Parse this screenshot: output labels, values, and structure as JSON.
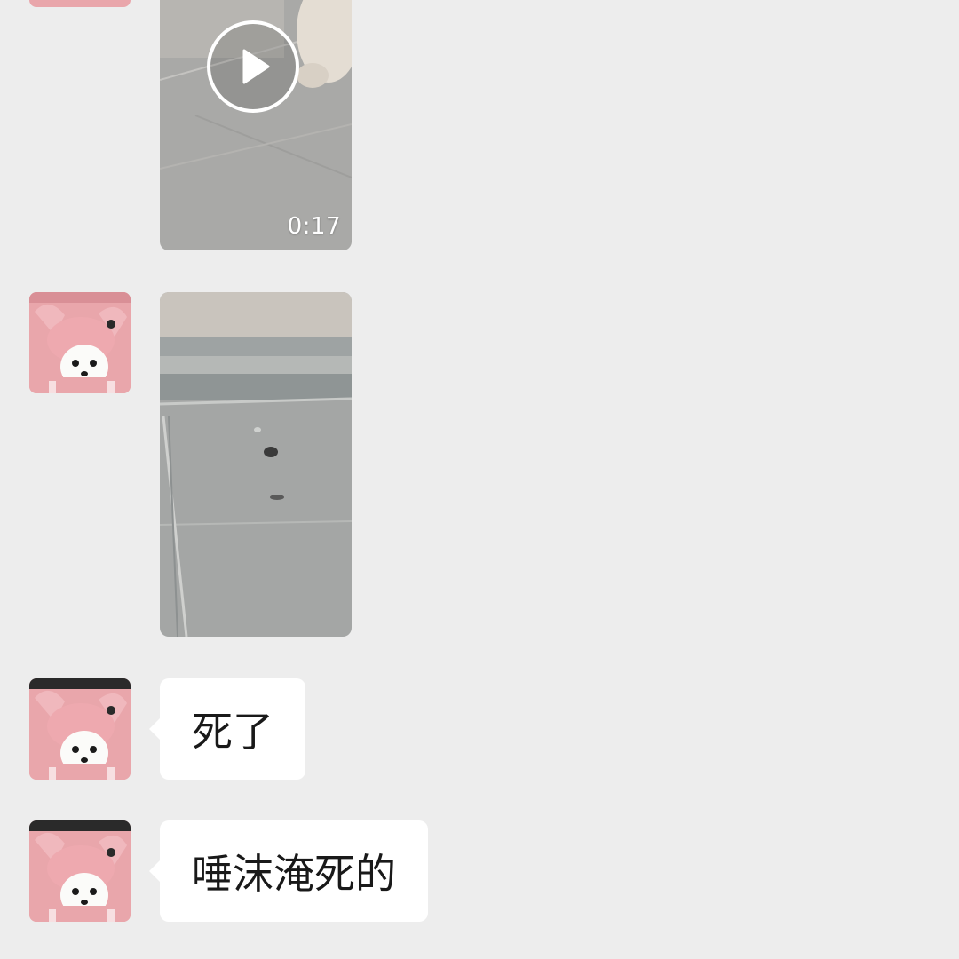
{
  "colors": {
    "background": "#ededed",
    "bubble": "#ffffff",
    "text": "#191919",
    "avatar_pink": "#e9a6ab"
  },
  "messages": [
    {
      "type": "video",
      "sender": "other",
      "duration": "0:17",
      "icon": "play-icon"
    },
    {
      "type": "image",
      "sender": "other"
    },
    {
      "type": "text",
      "sender": "other",
      "text": "死了"
    },
    {
      "type": "text",
      "sender": "other",
      "text": "唾沫淹死的"
    }
  ]
}
